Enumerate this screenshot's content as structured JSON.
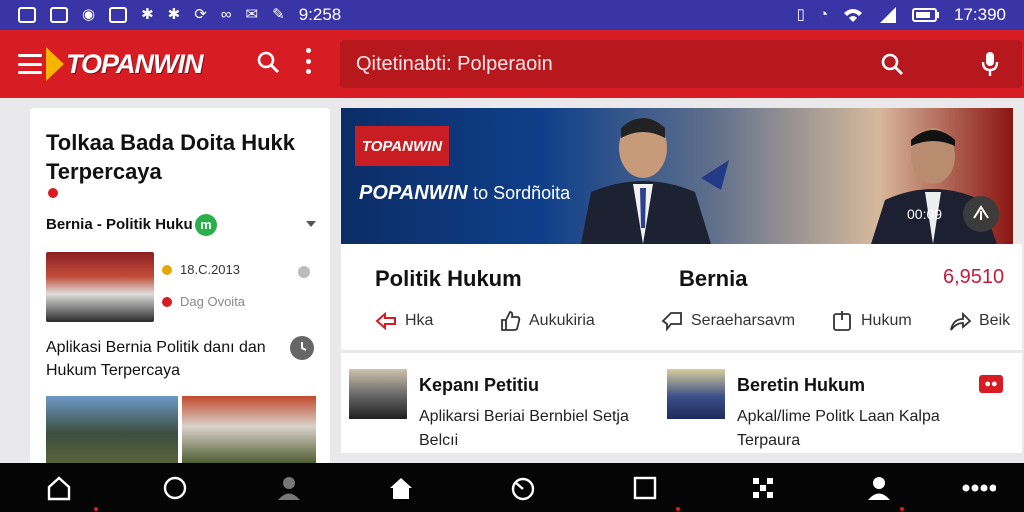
{
  "status_bar": {
    "left_time": "9:258",
    "right_time": "17:390"
  },
  "app_bar": {
    "logo_text_main": "TOPANWIN",
    "search_placeholder": "Qitetinabti: Polperaoin"
  },
  "left_panel": {
    "title": "Tolkaa Bada Doita Hukk Terpercaya",
    "category": "Bernia - Politik Huku",
    "category_badge": "m",
    "item_date": "18.C.2013",
    "item_source": "Dag Ovoita",
    "headline": "Aplikasi Bernia Politik danı dan Hukum Terpercaya"
  },
  "hero": {
    "logo_text": "TOPANWIN",
    "caption_main": "POPANWIN",
    "caption_sub": "to Sordñoita",
    "duration": "00:09"
  },
  "info_bar": {
    "title": "Politik Hukum",
    "category": "Bernia",
    "count": "6,9510",
    "actions": [
      {
        "label": "Hka",
        "icon": "share-arrow-icon"
      },
      {
        "label": "Aukukiria",
        "icon": "thumbs-up-icon"
      },
      {
        "label": "Seraeharsavm",
        "icon": "comment-icon"
      },
      {
        "label": "Hukum",
        "icon": "bookmark-icon"
      },
      {
        "label": "Beik",
        "icon": "forward-icon"
      }
    ]
  },
  "cards": [
    {
      "title": "Kepanı Petitiu",
      "body": "Aplikarsi Beriai Bernbiel Setja Belcıi"
    },
    {
      "title": "Beretin Hukum",
      "body": "Apkal/lime Politk Laan Kalpa Terpaura",
      "badge": "●●"
    }
  ],
  "colors": {
    "status_bar": "#3a35a6",
    "app_bar": "#d71c23",
    "search_box": "#b7181e",
    "nav_bar": "#050505",
    "accent_gold": "#f6b400"
  }
}
